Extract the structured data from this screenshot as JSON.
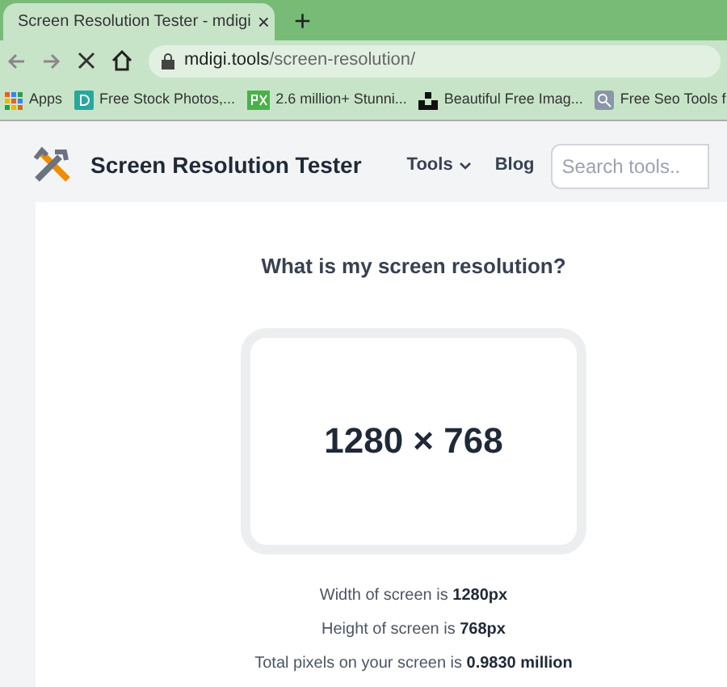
{
  "browser": {
    "tab": {
      "title": "Screen Resolution Tester - mdigi",
      "close": "×"
    },
    "new_tab": "+",
    "url": {
      "host": "mdigi.tools",
      "path": "/screen-resolution/"
    },
    "bookmarks": [
      {
        "kind": "apps",
        "label": "Apps"
      },
      {
        "kind": "d",
        "label": "Free Stock Photos,..."
      },
      {
        "kind": "px",
        "label": "2.6 million+ Stunni..."
      },
      {
        "kind": "u",
        "label": "Beautiful Free Imag..."
      },
      {
        "kind": "seo",
        "label": "Free Seo Tools f"
      }
    ]
  },
  "header": {
    "site_title": "Screen Resolution Tester",
    "nav": [
      "Tools",
      "Blog"
    ],
    "search": {
      "placeholder": "Search tools.."
    }
  },
  "card": {
    "heading": "What is my screen resolution?",
    "resolution": "1280 × 768",
    "facts": [
      "Width of screen is **1280px**",
      "Height of screen is **768px**",
      "Total pixels on your screen is **0.9830 million**"
    ]
  }
}
